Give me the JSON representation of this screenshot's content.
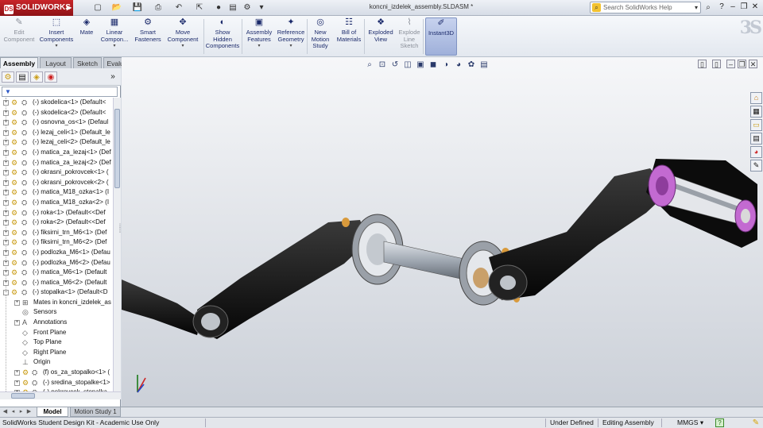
{
  "app": {
    "name": "SOLIDWORKS",
    "logo_badge": "DS"
  },
  "title_bar": {
    "document_title": "koncni_izdelek_assembly.SLDASM *",
    "search_placeholder": "Search SolidWorks Help",
    "icons": [
      "new-icon",
      "open-icon",
      "save-icon",
      "print-icon",
      "undo-icon",
      "select-icon",
      "rebuild-icon",
      "options-icon"
    ]
  },
  "ribbon": {
    "buttons": [
      {
        "label": "Edit\nComponent",
        "icon": "✎",
        "enabled": false
      },
      {
        "label": "Insert\nComponents",
        "icon": "⬚",
        "enabled": true,
        "dropdown": true
      },
      {
        "label": "Mate",
        "icon": "◈",
        "enabled": true
      },
      {
        "label": "Linear\nCompon...",
        "icon": "▦",
        "enabled": true,
        "dropdown": true
      },
      {
        "label": "Smart\nFasteners",
        "icon": "⚙",
        "enabled": true
      },
      {
        "label": "Move\nComponent",
        "icon": "✥",
        "enabled": true,
        "dropdown": true
      },
      {
        "label": "Show\nHidden\nComponents",
        "icon": "◐",
        "enabled": true
      },
      {
        "label": "Assembly\nFeatures",
        "icon": "▣",
        "enabled": true,
        "dropdown": true
      },
      {
        "label": "Reference\nGeometry",
        "icon": "✦",
        "enabled": true,
        "dropdown": true
      },
      {
        "label": "New\nMotion\nStudy",
        "icon": "◎",
        "enabled": true
      },
      {
        "label": "Bill of\nMaterials",
        "icon": "☷",
        "enabled": true
      },
      {
        "label": "Exploded\nView",
        "icon": "❖",
        "enabled": true
      },
      {
        "label": "Explode\nLine\nSketch",
        "icon": "⌇",
        "enabled": false
      },
      {
        "label": "Instant3D",
        "icon": "✐",
        "enabled": true,
        "active": true
      }
    ]
  },
  "tabs": {
    "assembly": "Assembly",
    "layout": "Layout",
    "sketch": "Sketch",
    "evaluate": "Evaluate"
  },
  "feature_manager": {
    "filter_symbol": "▼",
    "tree": [
      {
        "label": "(-) skodelica<1> (Default<",
        "kind": "component"
      },
      {
        "label": "(-) skodelica<2> (Default<",
        "kind": "component"
      },
      {
        "label": "(-) osnovna_os<1> (Defaul",
        "kind": "component"
      },
      {
        "label": "(-) lezaj_celi<1> (Default_le",
        "kind": "component"
      },
      {
        "label": "(-) lezaj_celi<2> (Default_le",
        "kind": "component"
      },
      {
        "label": "(-) matica_za_lezaj<1> (Def",
        "kind": "component"
      },
      {
        "label": "(-) matica_za_lezaj<2> (Def",
        "kind": "component"
      },
      {
        "label": "(-) okrasni_pokrovcek<1> (",
        "kind": "component"
      },
      {
        "label": "(-) okrasni_pokrovcek<2> (",
        "kind": "component"
      },
      {
        "label": "(-) matica_M18_ozka<1> (I",
        "kind": "component"
      },
      {
        "label": "(-) matica_M18_ozka<2> (I",
        "kind": "component"
      },
      {
        "label": "(-) roka<1> (Default<<Def",
        "kind": "component"
      },
      {
        "label": "(-) roka<2> (Default<<Def",
        "kind": "component"
      },
      {
        "label": "(-) fiksirni_trn_M6<1> (Def",
        "kind": "component"
      },
      {
        "label": "(-) fiksirni_trn_M6<2> (Def",
        "kind": "component"
      },
      {
        "label": "(-) podlozka_M6<1> (Defau",
        "kind": "component"
      },
      {
        "label": "(-) podlozka_M6<2> (Defau",
        "kind": "component"
      },
      {
        "label": "(-) matica_M6<1> (Default",
        "kind": "component"
      },
      {
        "label": "(-) matica_M6<2> (Default",
        "kind": "component"
      },
      {
        "label": "(-) stopalka<1> (Default<D",
        "kind": "expanded"
      },
      {
        "label": "Mates in koncni_izdelek_as",
        "kind": "sub-exp"
      },
      {
        "label": "Sensors",
        "kind": "sub"
      },
      {
        "label": "Annotations",
        "kind": "sub-exp"
      },
      {
        "label": "Front Plane",
        "kind": "sub"
      },
      {
        "label": "Top Plane",
        "kind": "sub"
      },
      {
        "label": "Right Plane",
        "kind": "sub"
      },
      {
        "label": "Origin",
        "kind": "sub"
      },
      {
        "label": "(f) os_za_stopalko<1> (",
        "kind": "sub2"
      },
      {
        "label": "(-) sredina_stopalke<1>",
        "kind": "sub2"
      },
      {
        "label": "(-) pokrovcek_stopalka",
        "kind": "sub2"
      }
    ]
  },
  "bottom_tabs": {
    "model": "Model",
    "motion": "Motion Study 1"
  },
  "status_bar": {
    "edition": "SolidWorks Student Design Kit - Academic Use Only",
    "definition": "Under Defined",
    "mode": "Editing Assembly",
    "units": "MMGS",
    "units_arrow": "▾",
    "help": "?"
  },
  "colors": {
    "accent": "#c8252a",
    "arm": "#111111",
    "axle": "#9ea6b0",
    "pedal_cap": "#c36ad1",
    "nut": "#d89a3c"
  }
}
